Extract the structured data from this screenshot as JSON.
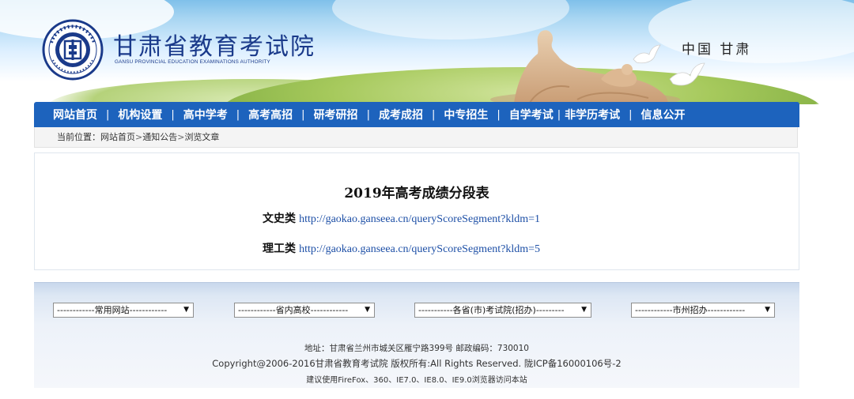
{
  "header": {
    "site_name_cn": "甘肃省教育考试院",
    "site_name_en": "GANSU PROVINCIAL EDUCATION EXAMINATIONS AUTHORITY",
    "region_text": "中国 甘肃",
    "colors": {
      "brand_blue": "#1d63bd",
      "title_blue": "#1a3a8a"
    }
  },
  "nav": {
    "items": [
      {
        "label": "网站首页"
      },
      {
        "label": "机构设置"
      },
      {
        "label": "高中学考"
      },
      {
        "label": "高考高招"
      },
      {
        "label": "研考研招"
      },
      {
        "label": "成考成招"
      },
      {
        "label": "中专招生"
      },
      {
        "label": "自学考试"
      },
      {
        "label": "非学历考试"
      },
      {
        "label": "信息公开"
      }
    ]
  },
  "breadcrumb": {
    "prefix": "当前位置：",
    "items": [
      "网站首页",
      "通知公告",
      "浏览文章"
    ],
    "separator": ">"
  },
  "article": {
    "title": "2019年高考成绩分段表",
    "links": [
      {
        "category": "文史类",
        "url": "http://gaokao.ganseea.cn/queryScoreSegment?kldm=1"
      },
      {
        "category": "理工类",
        "url": "http://gaokao.ganseea.cn/queryScoreSegment?kldm=5"
      }
    ]
  },
  "footer": {
    "selects": [
      {
        "value": "------------常用网站------------"
      },
      {
        "value": "------------省内高校------------"
      },
      {
        "value": "-----------各省(市)考试院(招办)---------"
      },
      {
        "value": "------------市州招办------------"
      }
    ],
    "address": "地址：甘肃省兰州市城关区雁宁路399号 邮政编码：730010",
    "copyright": "Copyright@2006-2016甘肃省教育考试院  版权所有:All Rights Reserved. 陇ICP备16000106号-2",
    "browser_note": "建议使用FireFox、360、IE7.0、IE8.0、IE9.0浏览器访问本站"
  }
}
